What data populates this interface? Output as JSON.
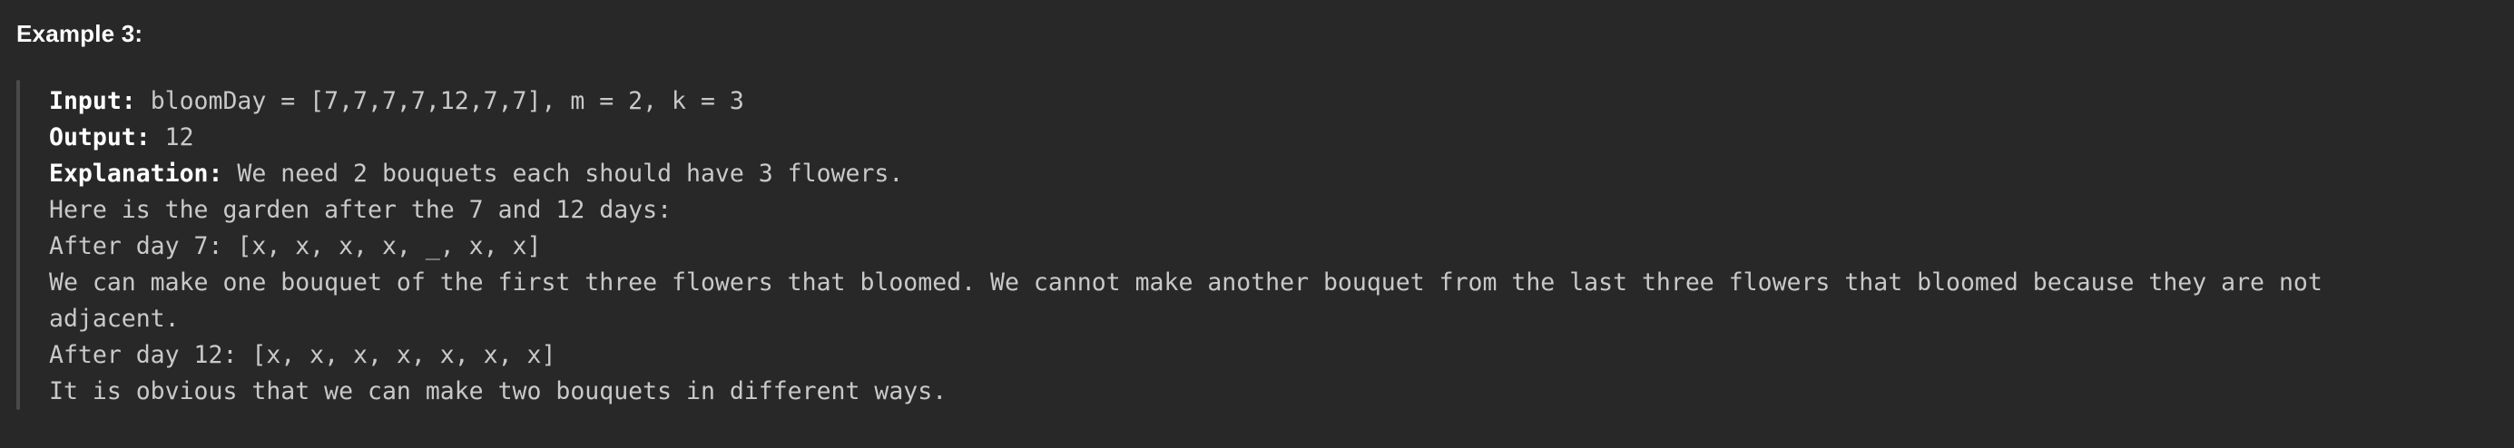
{
  "heading": "Example 3:",
  "example": {
    "input_label": "Input:",
    "input_value": " bloomDay = [7,7,7,7,12,7,7], m = 2, k = 3",
    "output_label": "Output:",
    "output_value": " 12",
    "explanation_label": "Explanation:",
    "explanation_value": " We need 2 bouquets each should have 3 flowers.",
    "lines": [
      "Here is the garden after the 7 and 12 days:",
      "After day 7: [x, x, x, x, _, x, x]",
      "We can make one bouquet of the first three flowers that bloomed. We cannot make another bouquet from the last three flowers that bloomed because they are not",
      "adjacent.",
      "After day 12: [x, x, x, x, x, x, x]",
      "It is obvious that we can make two bouquets in different ways."
    ]
  }
}
